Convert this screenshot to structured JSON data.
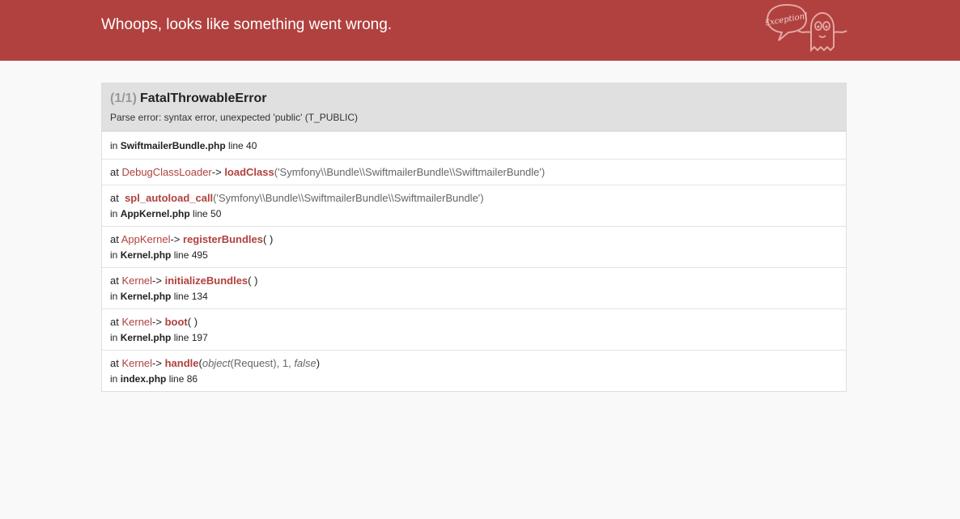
{
  "header": {
    "title": "Whoops, looks like something went wrong.",
    "mascot_text": "Exception!"
  },
  "exception": {
    "count": "(1/1)",
    "name": "FatalThrowableError",
    "message": "Parse error: syntax error, unexpected 'public' (T_PUBLIC)"
  },
  "trace": {
    "first": {
      "in": "in",
      "file": "SwiftmailerBundle.php",
      "line": "line 40"
    },
    "f1": {
      "at": "at",
      "class": "DebugClassLoader",
      "arrow": "->",
      "fn": "loadClass",
      "args": "('Symfony\\\\Bundle\\\\SwiftmailerBundle\\\\SwiftmailerBundle')"
    },
    "f2": {
      "at": "at",
      "fn": "spl_autoload_call",
      "args": "('Symfony\\\\Bundle\\\\SwiftmailerBundle\\\\SwiftmailerBundle')",
      "in": "in",
      "file": "AppKernel.php",
      "line": "line 50"
    },
    "f3": {
      "at": "at",
      "class": "AppKernel",
      "arrow": "->",
      "fn": "registerBundles",
      "args": "( )",
      "in": "in",
      "file": "Kernel.php",
      "line": "line 495"
    },
    "f4": {
      "at": "at",
      "class": "Kernel",
      "arrow": "->",
      "fn": "initializeBundles",
      "args": "( )",
      "in": "in",
      "file": "Kernel.php",
      "line": "line 134"
    },
    "f5": {
      "at": "at",
      "class": "Kernel",
      "arrow": "->",
      "fn": "boot",
      "args": "( )",
      "in": "in",
      "file": "Kernel.php",
      "line": "line 197"
    },
    "f6": {
      "at": "at",
      "class": "Kernel",
      "arrow": "->",
      "fn": "handle",
      "open": "(",
      "obj": "object",
      "obj_args": "(Request), 1, ",
      "bool": "false",
      "close": ")",
      "in": "in",
      "file": "index.php",
      "line": "line 86"
    }
  },
  "colors": {
    "header": "#b0413e",
    "accent": "#b0413e",
    "background": "#f9f9f9"
  }
}
